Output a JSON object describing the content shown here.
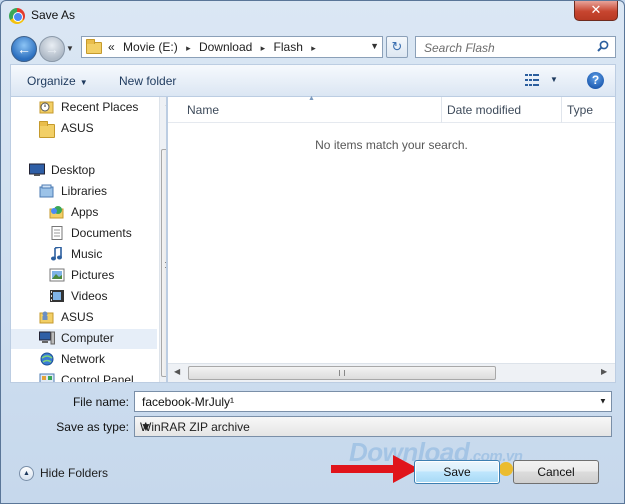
{
  "window": {
    "title": "Save As",
    "close_glyph": "✕"
  },
  "nav": {
    "back_glyph": "←",
    "forward_glyph": "→",
    "history_glyph": "▼"
  },
  "address": {
    "overflow": "«",
    "crumbs": [
      "Movie (E:)",
      "Download",
      "Flash"
    ],
    "separator": "▸",
    "dropdown_glyph": "▼",
    "refresh_glyph": "↻"
  },
  "search": {
    "placeholder": "Search Flash"
  },
  "toolbar": {
    "organize_label": "Organize",
    "caret_glyph": "▼",
    "new_folder_label": "New folder",
    "help_glyph": "?"
  },
  "navpane": {
    "items": [
      {
        "label": "Recent Places",
        "icon": "recent-places-icon"
      },
      {
        "label": "ASUS",
        "icon": "folder-icon"
      },
      {
        "label": "Desktop",
        "icon": "desktop-icon"
      },
      {
        "label": "Libraries",
        "icon": "libraries-icon"
      },
      {
        "label": "Apps",
        "icon": "apps-icon"
      },
      {
        "label": "Documents",
        "icon": "documents-icon"
      },
      {
        "label": "Music",
        "icon": "music-icon"
      },
      {
        "label": "Pictures",
        "icon": "pictures-icon"
      },
      {
        "label": "Videos",
        "icon": "videos-icon"
      },
      {
        "label": "ASUS",
        "icon": "user-folder-icon"
      },
      {
        "label": "Computer",
        "icon": "computer-icon",
        "selected": true
      },
      {
        "label": "Network",
        "icon": "network-icon"
      },
      {
        "label": "Control Panel",
        "icon": "control-panel-icon"
      }
    ]
  },
  "filelist": {
    "columns": [
      "Name",
      "Date modified",
      "Type"
    ],
    "sort_glyph": "▲",
    "empty_message": "No items match your search."
  },
  "scroll": {
    "up": "▲",
    "down": "▼",
    "left": "◀",
    "right": "▶"
  },
  "form": {
    "file_name_label": "File name:",
    "file_name_value": "facebook-MrJuly¹",
    "save_type_label": "Save as type:",
    "save_type_value": "WinRAR ZIP archive"
  },
  "footer": {
    "hide_folders_label": "Hide Folders",
    "hide_glyph": "▲",
    "save_label": "Save",
    "cancel_label": "Cancel"
  },
  "watermark": {
    "main": "Download",
    "suffix": ".com.vn"
  },
  "colors": {
    "accent": "#3c7fb1",
    "annotation_arrow": "#e0141b",
    "folder": "#f2cf66"
  }
}
